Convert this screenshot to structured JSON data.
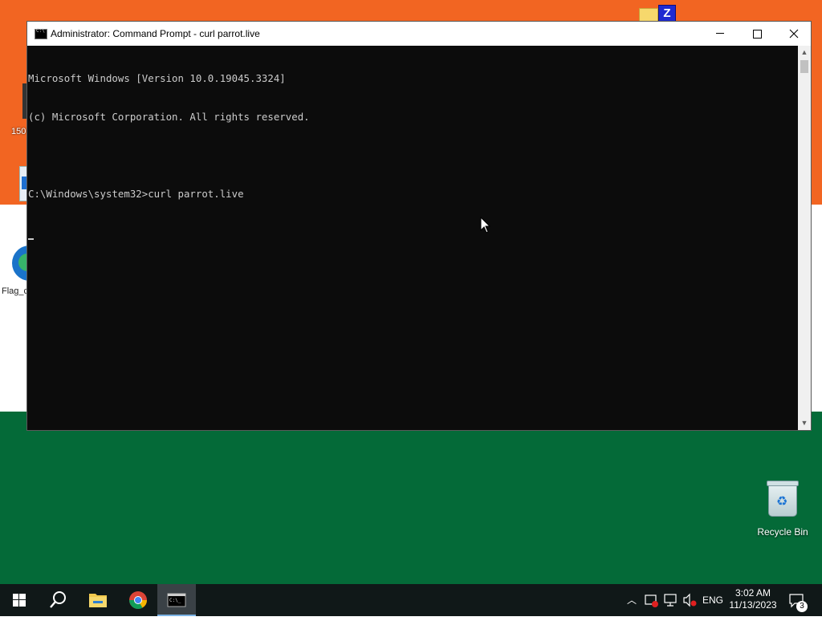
{
  "desktop": {
    "fragment_150": "150",
    "fragment_flag": "Flag_c",
    "recycle_bin_label": "Recycle Bin"
  },
  "window": {
    "title": "Administrator: Command Prompt - curl  parrot.live",
    "lines": [
      "Microsoft Windows [Version 10.0.19045.3324]",
      "(c) Microsoft Corporation. All rights reserved.",
      "",
      "C:\\Windows\\system32>curl parrot.live"
    ]
  },
  "taskbar": {
    "language": "ENG",
    "time": "3:02 AM",
    "date": "11/13/2023",
    "notification_count": "3"
  },
  "colors": {
    "saffron": "#f26522",
    "white": "#ffffff",
    "green": "#046a38",
    "console_bg": "#0c0c0c",
    "console_text": "#cccccc",
    "taskbar_bg": "#101818"
  }
}
